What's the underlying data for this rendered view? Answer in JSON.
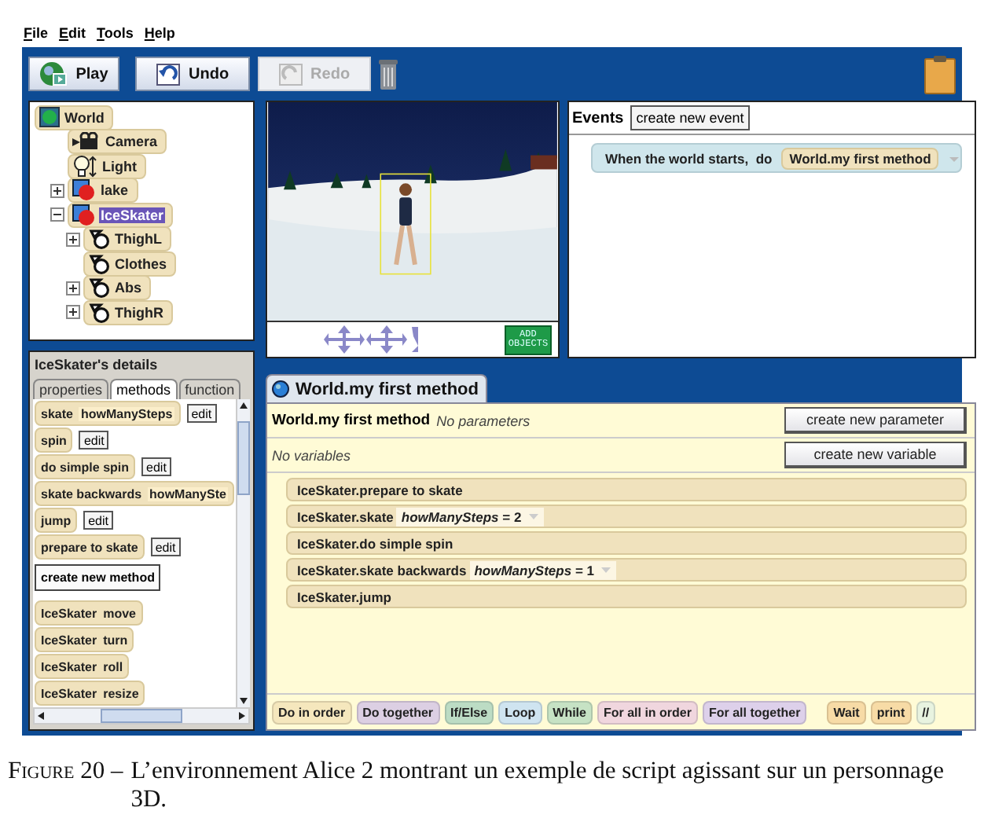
{
  "menu": [
    "File",
    "Edit",
    "Tools",
    "Help"
  ],
  "toolbar": [
    {
      "label": "Play",
      "kind": "play",
      "disabled": false
    },
    {
      "label": "Undo",
      "kind": "undo",
      "disabled": false
    },
    {
      "label": "Redo",
      "kind": "redo",
      "disabled": true
    }
  ],
  "object_tree": [
    {
      "label": "World",
      "kind": "world",
      "selected": false,
      "children": [
        {
          "label": "Camera",
          "kind": "camera",
          "selected": false
        },
        {
          "label": "Light",
          "kind": "light",
          "selected": false
        },
        {
          "label": "lake",
          "kind": "object",
          "expanded": false,
          "selected": false
        },
        {
          "label": "IceSkater",
          "kind": "object",
          "expanded": true,
          "selected": true,
          "children": [
            {
              "label": "ThighL",
              "kind": "part",
              "expanded": false,
              "selected": false
            },
            {
              "label": "Clothes",
              "kind": "part",
              "selected": false
            },
            {
              "label": "Abs",
              "kind": "part",
              "expanded": false,
              "selected": false
            },
            {
              "label": "ThighR",
              "kind": "part",
              "expanded": false,
              "selected": false
            }
          ]
        }
      ]
    }
  ],
  "scene": {
    "add_objects": "ADD OBJECTS"
  },
  "events": {
    "title": "Events",
    "create_button": "create new event",
    "items": [
      {
        "trigger": "When the world starts,  do",
        "method": "World.my first method"
      }
    ]
  },
  "details": {
    "title": "IceSkater's details",
    "tabs": [
      {
        "label": "properties",
        "selected": false
      },
      {
        "label": "methods",
        "selected": true
      },
      {
        "label": "function",
        "selected": false
      }
    ],
    "methods": [
      {
        "kind": "user",
        "name": "skate",
        "param": "howManySteps",
        "edit": "edit"
      },
      {
        "kind": "user",
        "name": "spin",
        "edit": "edit"
      },
      {
        "kind": "user",
        "name": "do simple spin",
        "edit": "edit"
      },
      {
        "kind": "user",
        "name": "skate backwards",
        "param": "howManySte"
      },
      {
        "kind": "user",
        "name": "jump",
        "edit": "edit"
      },
      {
        "kind": "user",
        "name": "prepare to skate",
        "edit": "edit"
      },
      {
        "kind": "button",
        "name": "create new method"
      },
      {
        "kind": "builtin",
        "object": "IceSkater",
        "name": "move"
      },
      {
        "kind": "builtin",
        "object": "IceSkater",
        "name": "turn"
      },
      {
        "kind": "builtin",
        "object": "IceSkater",
        "name": "roll"
      },
      {
        "kind": "builtin",
        "object": "IceSkater",
        "name": "resize"
      }
    ]
  },
  "editor": {
    "tab": "World.my first method",
    "method_name": "World.my first method",
    "parameters_note": "No parameters",
    "parameter_button": "create new parameter",
    "variables_note": "No variables",
    "variable_button": "create new variable",
    "statements": [
      {
        "text": "IceSkater.prepare to skate"
      },
      {
        "text": "IceSkater.skate",
        "arg": "*howManySteps* = 2"
      },
      {
        "text": "IceSkater.do simple spin"
      },
      {
        "text": "IceSkater.skate backwards",
        "arg": "*howManySteps* = 1"
      },
      {
        "text": "IceSkater.jump"
      }
    ]
  },
  "palette": [
    {
      "label": "Do in order",
      "color": "#f5e7bd"
    },
    {
      "label": "Do together",
      "color": "#dccfe3"
    },
    {
      "label": "If/Else",
      "color": "#bcdcc4"
    },
    {
      "label": "Loop",
      "color": "#cfe4f0"
    },
    {
      "label": "While",
      "color": "#c6e2c4"
    },
    {
      "label": "For all in order",
      "color": "#f0d6de"
    },
    {
      "label": "For all together",
      "color": "#ddd0ea"
    },
    {
      "label": "Wait",
      "color": "#f7dba6"
    },
    {
      "label": "print",
      "color": "#f7dba6"
    },
    {
      "label": "//",
      "color": "#e8f3e0"
    }
  ],
  "caption": {
    "label": "Figure 20 –",
    "text": "L’environnement Alice 2 montrant un exemple de script agissant sur un personnage 3D."
  }
}
